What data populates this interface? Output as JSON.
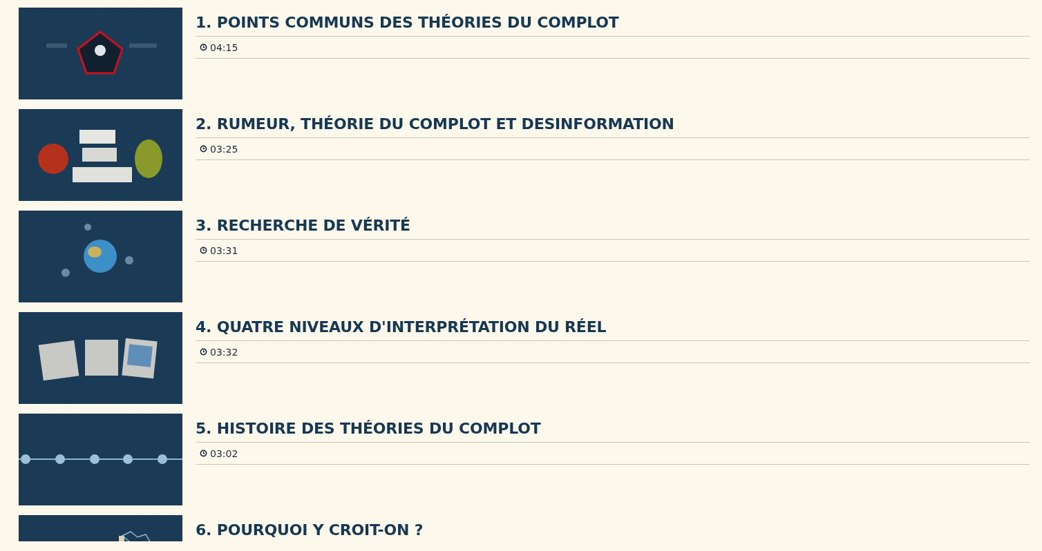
{
  "videos": [
    {
      "title": "1. POINTS COMMUNS DES THÉORIES DU COMPLOT",
      "duration": "04:15"
    },
    {
      "title": "2. RUMEUR, THÉORIE DU COMPLOT ET DESINFORMATION",
      "duration": "03:25"
    },
    {
      "title": "3. RECHERCHE DE VÉRITÉ",
      "duration": "03:31"
    },
    {
      "title": "4. QUATRE NIVEAUX D'INTERPRÉTATION DU RÉEL",
      "duration": "03:32"
    },
    {
      "title": "5. HISTOIRE DES THÉORIES DU COMPLOT",
      "duration": "03:02"
    },
    {
      "title": "6. POURQUOI Y CROIT-ON ?"
    }
  ]
}
